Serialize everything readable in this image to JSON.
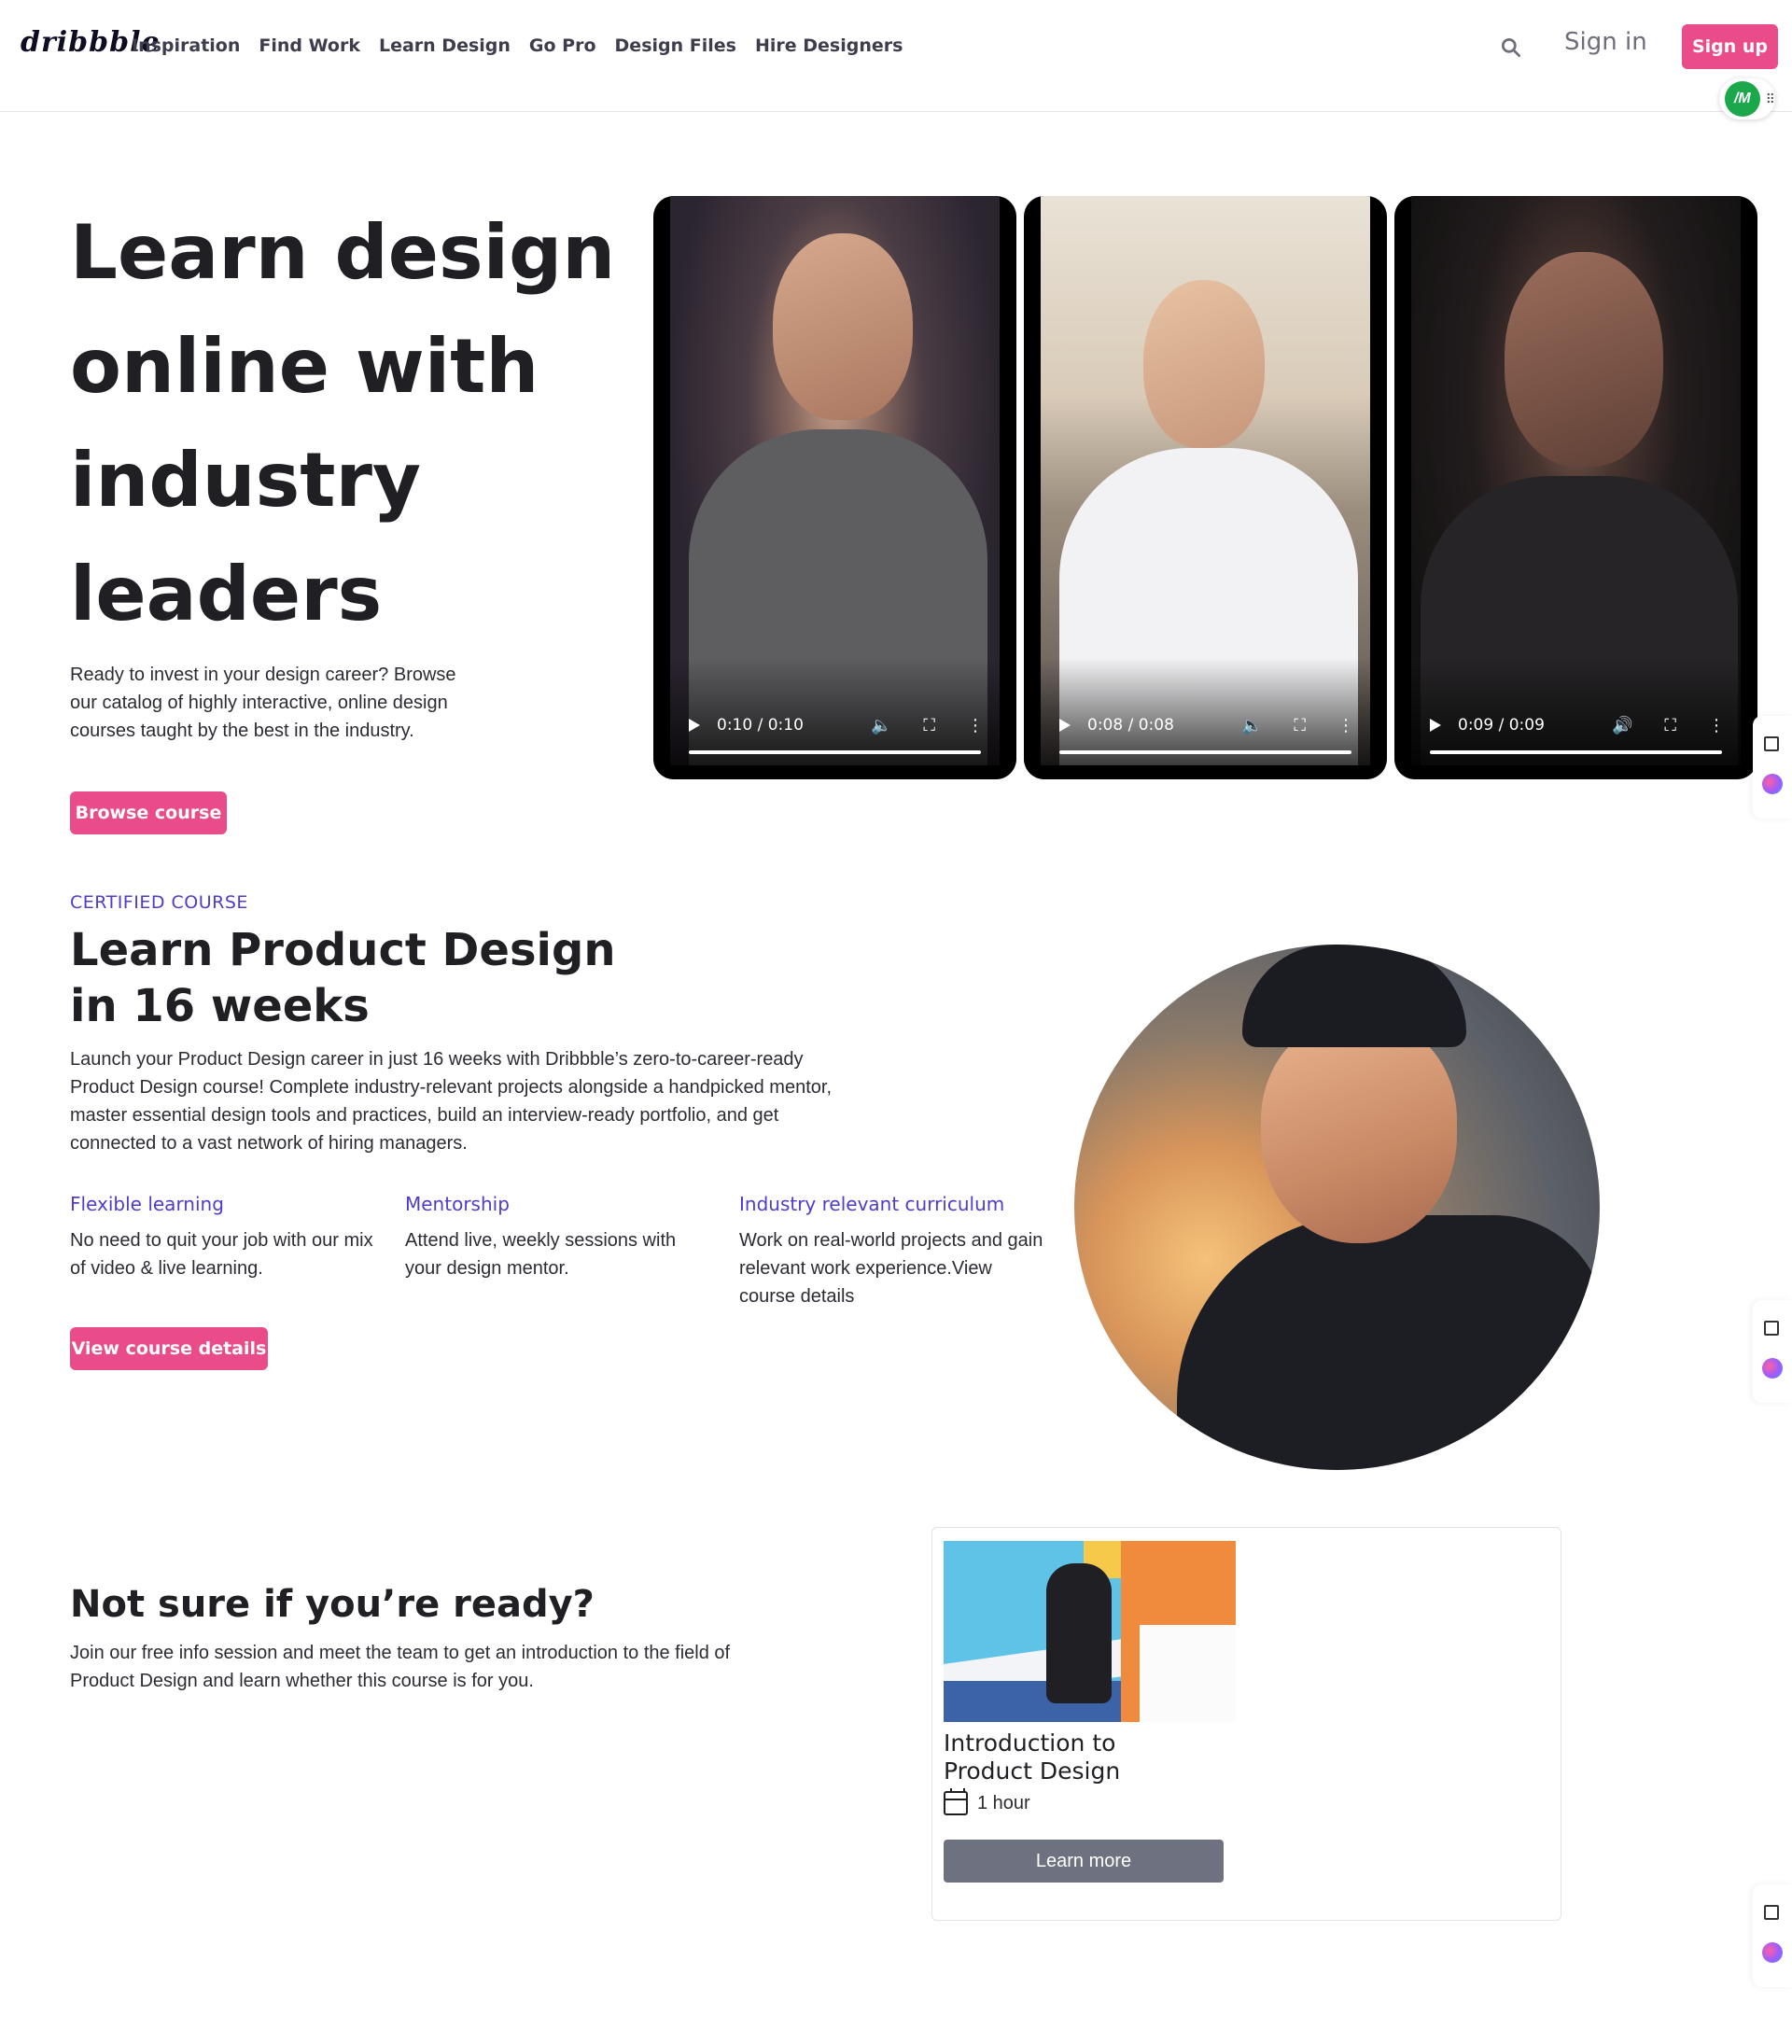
{
  "header": {
    "logo": "dribbble",
    "nav": [
      "Inspiration",
      "Find Work",
      "Learn Design",
      "Go Pro",
      "Design Files",
      "Hire Designers"
    ],
    "signin_label": "Sign in",
    "signup_label": "Sign up",
    "extension_badge": "/M",
    "brand_color": "#ea4c89"
  },
  "hero": {
    "title": "Learn design online with industry leaders",
    "description": "Ready to invest in your design career? Browse our catalog of highly interactive, online design courses taught by the best in the industry.",
    "browse_button": "Browse course",
    "videos": [
      {
        "time": "0:10 / 0:10",
        "progress": 1.0,
        "muted": true
      },
      {
        "time": "0:08 / 0:08",
        "progress": 1.0,
        "muted": true
      },
      {
        "time": "0:09 / 0:09",
        "progress": 1.0,
        "muted": false
      }
    ]
  },
  "course": {
    "label": "CERTIFIED COURSE",
    "title": "Learn Product Design in 16 weeks",
    "description": "Launch your Product Design career in just 16 weeks with Dribbble’s zero-to-career-ready Product Design course! Complete industry-relevant projects alongside a handpicked mentor, master essential design tools and practices, build an interview-ready portfolio, and get connected to a vast network of hiring managers.",
    "features": [
      {
        "title": "Flexible learning",
        "text": "No need to quit your job with our mix of video & live learning."
      },
      {
        "title": "Mentorship",
        "text": "Attend live, weekly sessions with your design mentor."
      },
      {
        "title": "Industry relevant curriculum",
        "text": "Work on real-world projects and gain relevant work experience.View course details"
      }
    ],
    "details_button": "View course details",
    "accent_color": "#4f3cc9"
  },
  "info_session": {
    "title": "Not sure if you’re ready?",
    "description": "Join our free info session and meet the team to get an introduction to the field of Product Design and learn whether this course is for you.",
    "card": {
      "title": "Introduction to Product Design",
      "duration": "1 hour",
      "button": "Learn more"
    }
  }
}
